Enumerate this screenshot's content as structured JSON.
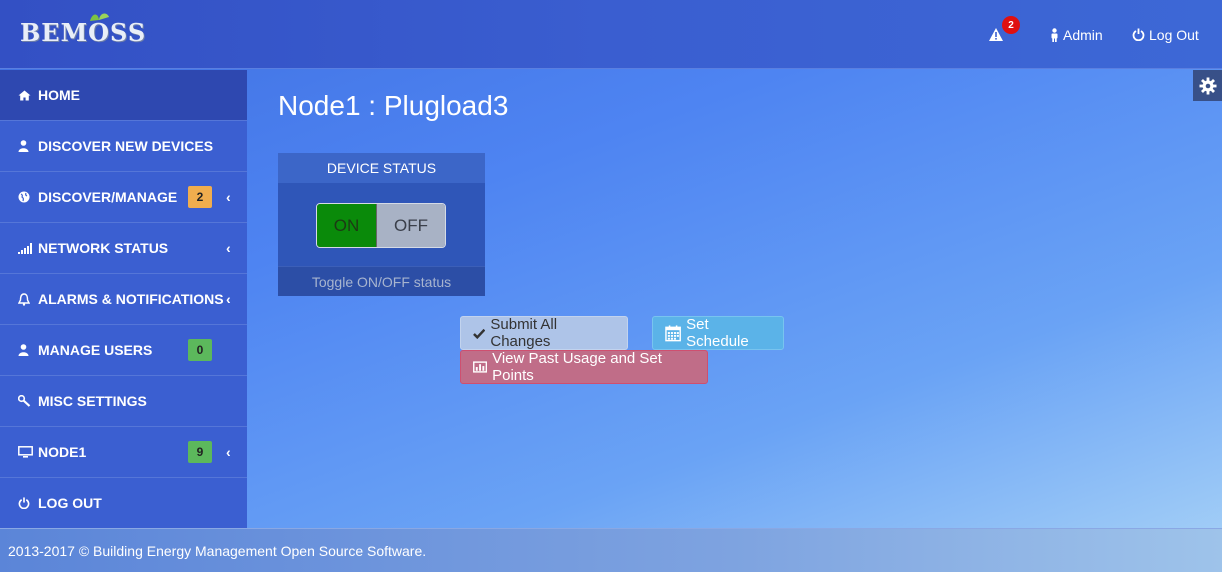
{
  "brand": {
    "logo_text": "BEMOSS"
  },
  "topbar": {
    "alert_count": "2",
    "admin_label": "Admin",
    "logout_label": "Log Out"
  },
  "sidebar": {
    "items": [
      {
        "label": "HOME",
        "icon": "home-icon",
        "active": true
      },
      {
        "label": "DISCOVER NEW DEVICES",
        "icon": "user-icon"
      },
      {
        "label": "DISCOVER/MANAGE",
        "icon": "globe-icon",
        "count": "2",
        "count_color": "#f0ad4e",
        "chevron": "‹"
      },
      {
        "label": "NETWORK STATUS",
        "icon": "signal-icon",
        "chevron": "‹"
      },
      {
        "label": "ALARMS & NOTIFICATIONS",
        "icon": "bell-icon",
        "chevron": "‹"
      },
      {
        "label": "MANAGE USERS",
        "icon": "user-icon",
        "count": "0",
        "count_color": "#5cb85c"
      },
      {
        "label": "MISC SETTINGS",
        "icon": "wrench-icon"
      },
      {
        "label": "NODE1",
        "icon": "monitor-icon",
        "count": "9",
        "count_color": "#5cb85c",
        "chevron": "‹"
      },
      {
        "label": "LOG OUT",
        "icon": "power-icon"
      }
    ]
  },
  "main": {
    "title": "Node1 : Plugload3",
    "device_status": {
      "heading": "DEVICE STATUS",
      "on_label": "ON",
      "off_label": "OFF",
      "footer": "Toggle ON/OFF status",
      "state": "ON"
    },
    "buttons": {
      "submit": "Submit All Changes",
      "schedule": "Set Schedule",
      "usage": "View Past Usage and Set Points"
    }
  },
  "footer": {
    "text": "2013-2017 © Building Energy Management Open Source Software."
  }
}
